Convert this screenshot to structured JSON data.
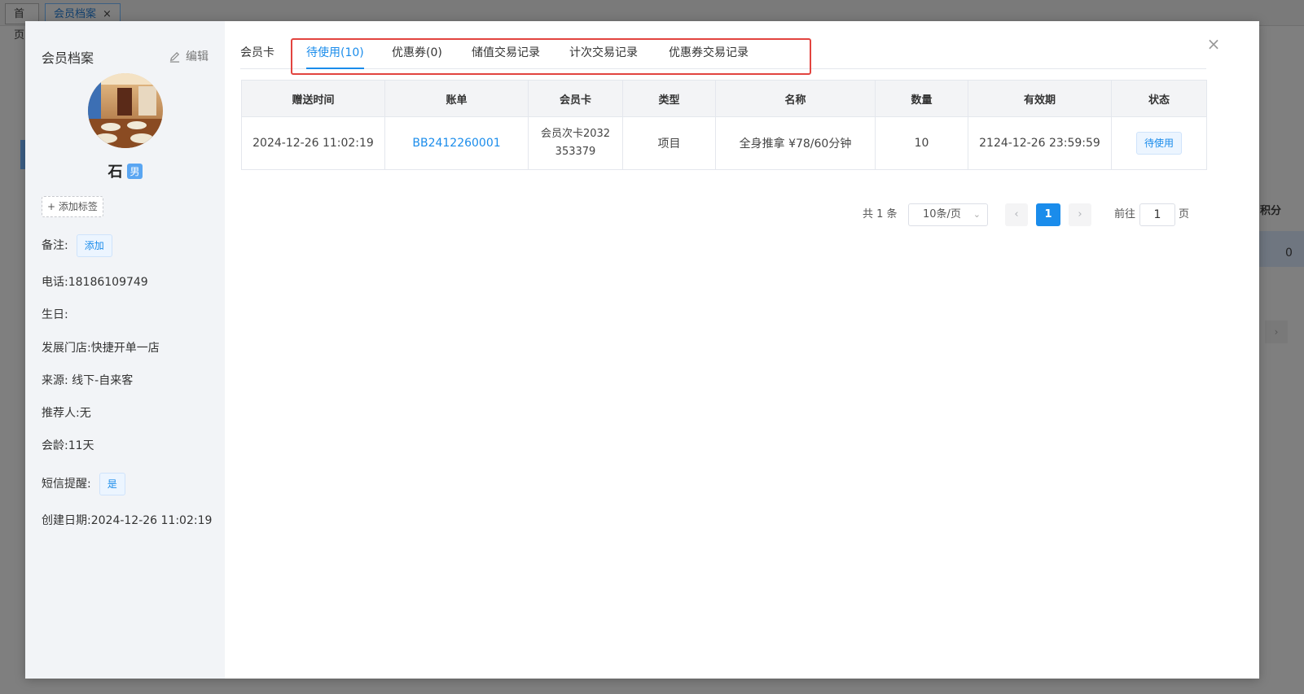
{
  "background": {
    "tabs": [
      {
        "label": "首页"
      },
      {
        "label": "会员档案",
        "close": "×"
      }
    ],
    "right_col_header": "积分",
    "right_col_value": "0",
    "next_icon": "›"
  },
  "profile": {
    "title": "会员档案",
    "edit_label": "编辑",
    "name": "石",
    "gender": "男",
    "add_tag": "+ 添加标签",
    "remark_label": "备注:",
    "remark_add": "添加",
    "phone": "电话:18186109749",
    "birthday": "生日:",
    "store": "发展门店:快捷开单一店",
    "source": "来源: 线下-自来客",
    "referrer": "推荐人:无",
    "member_age": "会龄:11天",
    "sms_label": "短信提醒:",
    "sms_value": "是",
    "created": "创建日期:2024-12-26 11:02:19"
  },
  "tabs": [
    {
      "label": "会员卡"
    },
    {
      "label": "待使用(10)"
    },
    {
      "label": "优惠券(0)"
    },
    {
      "label": "储值交易记录"
    },
    {
      "label": "计次交易记录"
    },
    {
      "label": "优惠券交易记录"
    }
  ],
  "active_tab": "待使用(10)",
  "table": {
    "headers": [
      "赠送时间",
      "账单",
      "会员卡",
      "类型",
      "名称",
      "数量",
      "有效期",
      "状态"
    ],
    "rows": [
      {
        "time": "2024-12-26 11:02:19",
        "bill": "BB2412260001",
        "card": "会员次卡2032353379",
        "type": "项目",
        "name": "全身推拿 ¥78/60分钟",
        "qty": "10",
        "expiry": "2124-12-26 23:59:59",
        "status": "待使用"
      }
    ]
  },
  "pagination": {
    "total": "共 1 条",
    "page_size": "10条/页",
    "current": "1",
    "goto_label": "前往",
    "goto_value": "1",
    "goto_suffix": "页"
  },
  "colors": {
    "accent": "#1a8ceb",
    "highlight": "#e2443f"
  }
}
